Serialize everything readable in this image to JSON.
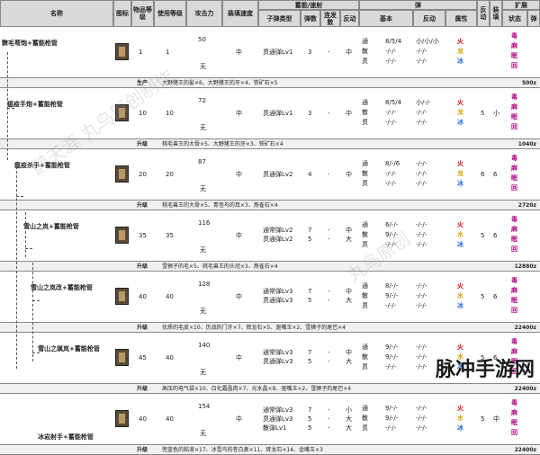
{
  "headers": {
    "name": "名称",
    "icon": "图标",
    "item_level": "物品等级",
    "use_level": "使用等级",
    "attack": "攻击力",
    "slot": "装填速度",
    "ammo_group": "蓄能/速射",
    "ammo_type": "子弹类型",
    "ammo_count": "弹数",
    "fire_count": "连发数",
    "recoil": "反动",
    "bullet": "弹",
    "basic": "基本",
    "bullet_recoil": "反动",
    "attr": "属性",
    "recoil2": "反动",
    "reload": "装填",
    "expand": "扩展",
    "status": "状态",
    "special": "弹"
  },
  "rows": [
    {
      "name": "髀毛萼炮+蓄能枪管",
      "item_level": "1",
      "use_level": "1",
      "attack": "50",
      "attack_sub": "无",
      "slot": "中",
      "ammo": "贯通弹Lv1",
      "count": "3",
      "fire": "-",
      "recoil": "中",
      "basic": [
        "8/5/4",
        "-/-/-",
        "-/-/-"
      ],
      "mini": [
        "小/小/小",
        "-/-/-",
        "-/-/-"
      ],
      "elem": [
        "火",
        "龙",
        "冰"
      ],
      "reload": "",
      "status": [
        "毒",
        "麻",
        "眠",
        "回"
      ],
      "side": "",
      "foot_label": "生产",
      "foot_text": "大野猪王的髪×6、大野猪王的牙×4、铁矿石×5",
      "cost": "500z"
    },
    {
      "name": "瘟疫手炮+蓄能枪管",
      "item_level": "10",
      "use_level": "10",
      "attack": "72",
      "attack_sub": "无",
      "slot": "中",
      "ammo": "贯通弹Lv1",
      "count": "3",
      "fire": "-",
      "recoil": "中",
      "basic": [
        "8/5/4",
        "-/-/-",
        "-/-/-"
      ],
      "mini": [
        "小/-/-",
        "-/-/-",
        "-/-/-"
      ],
      "elem": [
        "火",
        "龙",
        "冰"
      ],
      "reload": "5",
      "status": [
        "毒",
        "麻",
        "眠",
        "回"
      ],
      "side": "小",
      "foot_label": "升级",
      "foot_text": "桃毛兽王的大骨×5、大野猪王的牙×3、铁矿石×4",
      "cost": "1040z"
    },
    {
      "name": "瘟疫杀手+蓄能枪管",
      "item_level": "20",
      "use_level": "20",
      "attack": "87",
      "attack_sub": "无",
      "slot": "中",
      "ammo": "贯通弹Lv2",
      "count": "4",
      "fire": "-",
      "recoil": "中",
      "basic": [
        "8/-/6",
        "-/-/-",
        "-/-/-"
      ],
      "mini": [
        "-/-/-",
        "-/-/-",
        "-/-/-"
      ],
      "elem": [
        "火",
        "龙",
        "冰"
      ],
      "reload": "6",
      "status": [
        "毒",
        "麻",
        "眠",
        "回"
      ],
      "side": "6",
      "foot_label": "升级",
      "foot_text": "桃毛兽王的大骨×5、青怪鸟的耳×3、燕雀石×4",
      "cost": "2720z"
    },
    {
      "name": "雪山之岚+蓄能枪管",
      "item_level": "35",
      "use_level": "35",
      "attack": "116",
      "attack_sub": "无",
      "slot": "中",
      "ammo": "通常弹Lv2 / 贯通弹Lv2",
      "count": "7 / 5",
      "fire": "- / -",
      "recoil": "中 / 大",
      "basic": [
        "6/-/-",
        "9/-/-",
        "-/-/-"
      ],
      "mini": [
        "-/-/-",
        "-/-/-",
        "-/-/-"
      ],
      "elem": [
        "火",
        "水",
        "冰"
      ],
      "reload": "5",
      "status": [
        "毒",
        "麻",
        "眠",
        "回"
      ],
      "side": "6",
      "foot_label": "升级",
      "foot_text": "雪狮子的毛×5、桃毛兽王的头冠×3、燕雀石×4",
      "cost": "12880z"
    },
    {
      "name": "雪山之岚改+蓄能枪管",
      "item_level": "40",
      "use_level": "40",
      "attack": "128",
      "attack_sub": "无",
      "slot": "中",
      "ammo": "通常弹Lv3 / 贯通弹Lv3",
      "count": "7 / 5",
      "fire": "- / -",
      "recoil": "中 / 大",
      "basic": [
        "8/-/-",
        "9/-/-",
        "-/-/-"
      ],
      "mini": [
        "-/-/-",
        "-/-/-",
        "-/-/-"
      ],
      "elem": [
        "火",
        "水",
        "冰"
      ],
      "reload": "5",
      "status": [
        "毒",
        "麻",
        "眠",
        "回"
      ],
      "side": "6",
      "foot_label": "升级",
      "foot_text": "优质的毛皮×10、历战的门牙×7、辉龙石×5、驱嘴玉×2、雪狮子的尾巴×4",
      "cost": "22400z"
    },
    {
      "name": "雪山之飒岚+蓄能枪管",
      "item_level": "45",
      "use_level": "40",
      "attack": "140",
      "attack_sub": "无",
      "slot": "中",
      "ammo": "通常弹Lv3 / 贯通弹Lv3",
      "count": "7 / 5",
      "fire": "- / -",
      "recoil": "中 / 大",
      "basic": [
        "9/-/-",
        "9/-/-",
        "-/-/-"
      ],
      "mini": [
        "-/-/-",
        "-/-/-",
        "-/-/-"
      ],
      "elem": [
        "火",
        "水",
        "冰"
      ],
      "reload": "5",
      "status": [
        "毒",
        "麻",
        "眠",
        "回"
      ],
      "side": "6",
      "foot_label": "升级",
      "foot_text": "高压的电气袋×10、白化霜晶肉×7、光水晶×8、驱嘴玉×2、雪狮子的尾巴×4",
      "cost": "22400z"
    },
    {
      "name": "冰岩射手+蓄能枪管",
      "item_level": "40",
      "use_level": "40",
      "attack": "154",
      "attack_sub": "无",
      "slot": "中",
      "ammo": "通常弹Lv3 / 贯通弹Lv3 / 散弹Lv1",
      "count": "7 / 5 / 5",
      "fire": "- / - / -",
      "recoil": "小 / 大 / 大",
      "basic": [
        "9/-/-",
        "9/-/-",
        "-/-/-"
      ],
      "mini": [
        "-/-/-",
        "-/-/-",
        "-/-/-"
      ],
      "elem": [
        "火",
        "水",
        "冰"
      ],
      "reload": "5",
      "status": [
        "毒",
        "麻",
        "眠",
        "回"
      ],
      "side": "中",
      "foot_label": "升级",
      "foot_text": "兜蓝色的粘液×17、冰雪鸟的苍白鼻×11、辉龙石×14、金嘴玉×3",
      "cost": "22400z"
    }
  ],
  "row_labels": {
    "pierce": "贯",
    "scatter": "散",
    "normal": "通",
    "elem_split": "通散贯"
  },
  "watermark": "脉冲手游网",
  "watermark_bg": [
    "醉天涯 丸鸟原创制作",
    "丸鸟原创"
  ],
  "colors": {
    "fire": "#d00000",
    "water": "#d3a000",
    "ice": "#2a6bd8",
    "status": "#b00080"
  }
}
